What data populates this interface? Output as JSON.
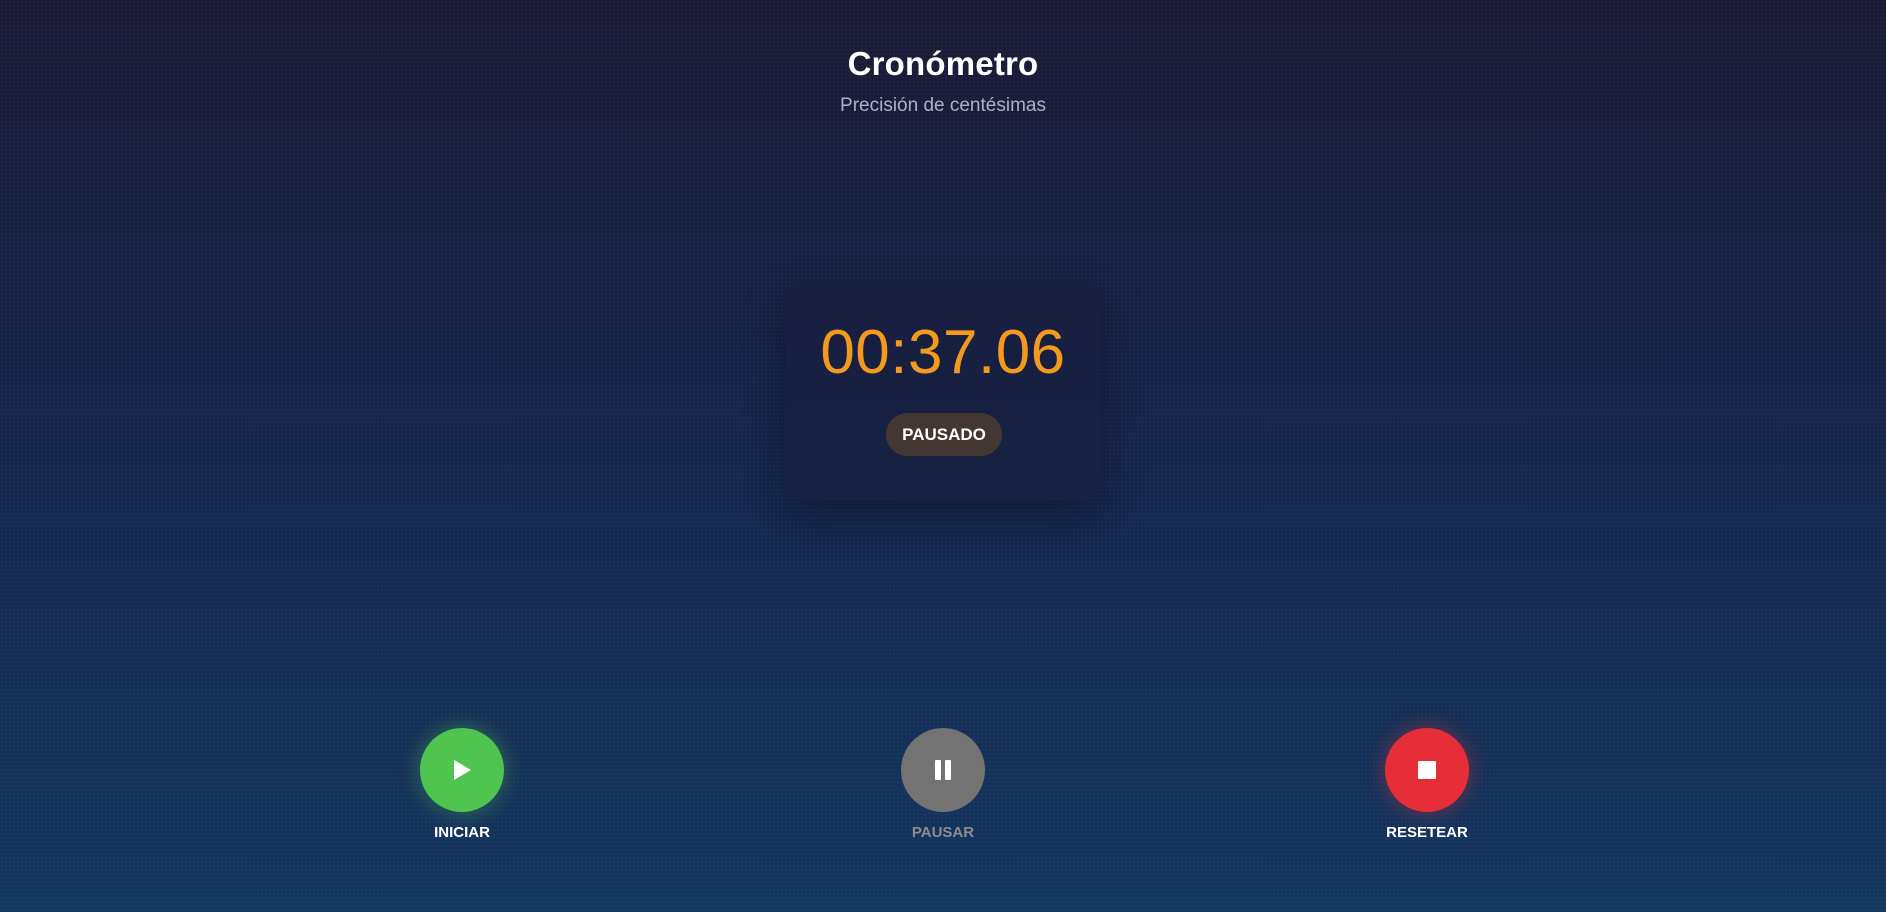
{
  "header": {
    "title": "Cronómetro",
    "subtitle": "Precisión de centésimas"
  },
  "timer": {
    "display": "00:37.06",
    "status": "PAUSADO"
  },
  "controls": {
    "start": {
      "label": "INICIAR",
      "icon": "play-icon",
      "color": "#4fc54f"
    },
    "pause": {
      "label": "PAUSAR",
      "icon": "pause-icon",
      "color": "#737373"
    },
    "reset": {
      "label": "RESETEAR",
      "icon": "stop-icon",
      "color": "#e52e38"
    }
  },
  "colors": {
    "accent": "#f39a1e",
    "status_badge": "#443731"
  }
}
